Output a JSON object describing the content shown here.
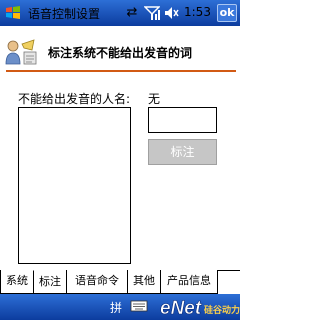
{
  "titlebar": {
    "title": "语音控制设置",
    "time": "1:53",
    "ok_label": "ok"
  },
  "header": {
    "heading": "标注系统不能给出发音的词"
  },
  "form": {
    "word_label": "不能给出发音的人名:",
    "word_value": "无",
    "pronunciation_value": "",
    "mark_button": "标注"
  },
  "tabs": [
    {
      "label": "系统",
      "active": false
    },
    {
      "label": "标注",
      "active": true
    },
    {
      "label": "语音命令",
      "active": false
    },
    {
      "label": "其他",
      "active": false
    },
    {
      "label": "产品信息",
      "active": false
    }
  ],
  "menubar": {
    "ime_label": "拼",
    "brand_logo_text": "eNet 硅谷动力"
  },
  "icons": {
    "start": "windows-flag-icon",
    "sync": "sync-arrows-icon",
    "signal": "signal-bars-icon",
    "volume": "speaker-mute-icon",
    "header": "voice-settings-icon",
    "keyboard": "keyboard-icon"
  },
  "colors": {
    "titlebar": "#1f56b8",
    "header_rule": "#d25a14",
    "disabled_button": "#c6c6c6"
  }
}
